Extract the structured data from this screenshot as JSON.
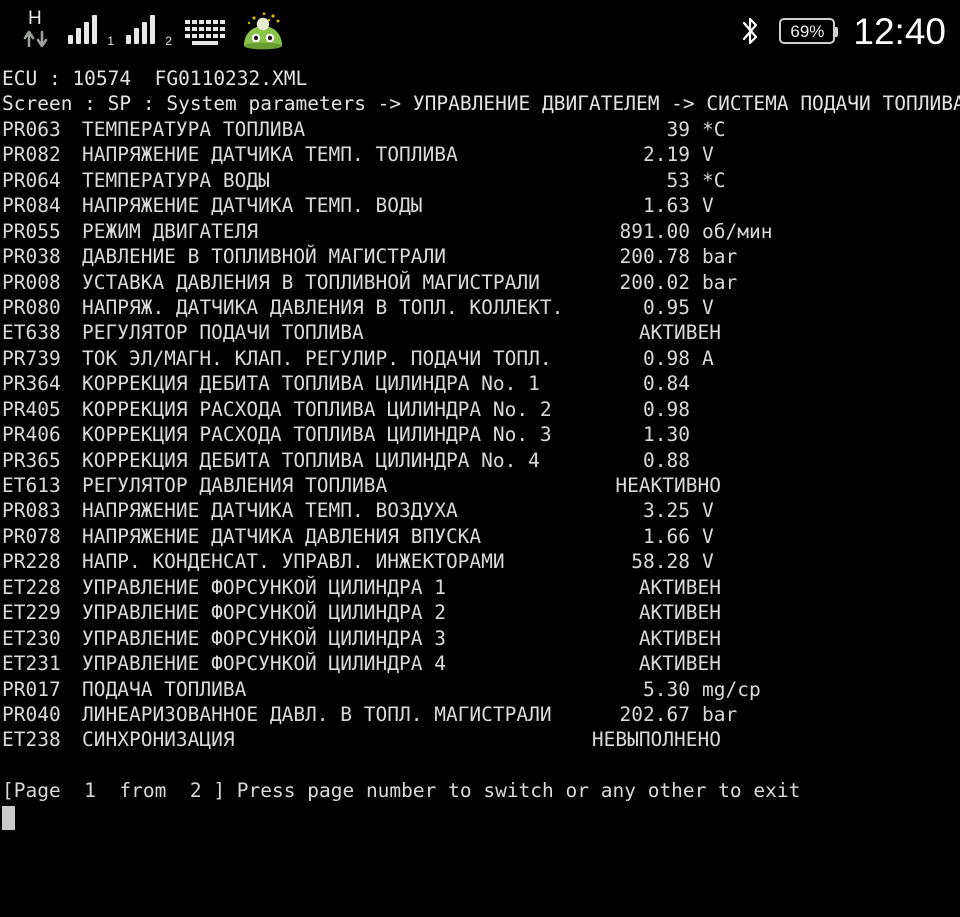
{
  "statusbar": {
    "network_type": "H",
    "sim1_label": "1",
    "sim2_label": "2",
    "icons": [
      "h-network-icon",
      "signal-bars-sim1-icon",
      "signal-bars-sim2-icon",
      "keyboard-icon",
      "android-mascot-icon",
      "bluetooth-icon"
    ],
    "battery_percent": "69%",
    "clock": "12:40",
    "colors": {
      "text": "#e8e8e8",
      "background": "#000000",
      "mascot_green": "#8bc34a"
    }
  },
  "header": {
    "ecu_line": "ECU : 10574  FG0110232.XML",
    "screen_line": "Screen : SP : System parameters -> УПРАВЛЕНИЕ ДВИГАТЕЛЕМ -> СИСТЕМА ПОДАЧИ ТОПЛИВА"
  },
  "rows": [
    {
      "code": "PR063",
      "label": "ТЕМПЕРАТУРА ТОПЛИВА",
      "value": "39",
      "unit": "*C",
      "kind": "num"
    },
    {
      "code": "PR082",
      "label": "НАПРЯЖЕНИЕ ДАТЧИКА ТЕМП. ТОПЛИВА",
      "value": "2.19",
      "unit": "V",
      "kind": "num"
    },
    {
      "code": "PR064",
      "label": "ТЕМПЕРАТУРА ВОДЫ",
      "value": "53",
      "unit": "*C",
      "kind": "num"
    },
    {
      "code": "PR084",
      "label": "НАПРЯЖЕНИЕ ДАТЧИКА ТЕМП. ВОДЫ",
      "value": "1.63",
      "unit": "V",
      "kind": "num"
    },
    {
      "code": "PR055",
      "label": "РЕЖИМ ДВИГАТЕЛЯ",
      "value": "891.00",
      "unit": "об/мин",
      "kind": "num"
    },
    {
      "code": "PR038",
      "label": "ДАВЛЕНИЕ В ТОПЛИВНОЙ МАГИСТРАЛИ",
      "value": "200.78",
      "unit": "bar",
      "kind": "num"
    },
    {
      "code": "PR008",
      "label": "УСТАВКА ДАВЛЕНИЯ В ТОПЛИВНОЙ МАГИСТРАЛИ",
      "value": "200.02",
      "unit": "bar",
      "kind": "num"
    },
    {
      "code": "PR080",
      "label": "НАПРЯЖ. ДАТЧИКА ДАВЛЕНИЯ В ТОПЛ. КОЛЛЕКТ.",
      "value": "0.95",
      "unit": "V",
      "kind": "num"
    },
    {
      "code": "ET638",
      "label": "РЕГУЛЯТОР ПОДАЧИ ТОПЛИВА",
      "value": "АКТИВЕН",
      "unit": "",
      "kind": "state"
    },
    {
      "code": "PR739",
      "label": "ТОК ЭЛ/МАГН. КЛАП. РЕГУЛИР. ПОДАЧИ ТОПЛ.",
      "value": "0.98",
      "unit": "A",
      "kind": "num"
    },
    {
      "code": "PR364",
      "label": "КОРРЕКЦИЯ ДЕБИТА ТОПЛИВА ЦИЛИНДРА No. 1",
      "value": "0.84",
      "unit": "",
      "kind": "num"
    },
    {
      "code": "PR405",
      "label": "КОРРЕКЦИЯ РАСХОДА ТОПЛИВА ЦИЛИНДРА No. 2",
      "value": "0.98",
      "unit": "",
      "kind": "num"
    },
    {
      "code": "PR406",
      "label": "КОРРЕКЦИЯ РАСХОДА ТОПЛИВА ЦИЛИНДРА No. 3",
      "value": "1.30",
      "unit": "",
      "kind": "num"
    },
    {
      "code": "PR365",
      "label": "КОРРЕКЦИЯ ДЕБИТА ТОПЛИВА ЦИЛИНДРА No. 4",
      "value": "0.88",
      "unit": "",
      "kind": "num"
    },
    {
      "code": "ET613",
      "label": "РЕГУЛЯТОР ДАВЛЕНИЯ ТОПЛИВА",
      "value": "НЕАКТИВНО",
      "unit": "",
      "kind": "state"
    },
    {
      "code": "PR083",
      "label": "НАПРЯЖЕНИЕ ДАТЧИКА ТЕМП. ВОЗДУХА",
      "value": "3.25",
      "unit": "V",
      "kind": "num"
    },
    {
      "code": "PR078",
      "label": "НАПРЯЖЕНИЕ ДАТЧИКА ДАВЛЕНИЯ ВПУСКА",
      "value": "1.66",
      "unit": "V",
      "kind": "num"
    },
    {
      "code": "PR228",
      "label": "НАПР. КОНДЕНСАТ. УПРАВЛ. ИНЖЕКТОРАМИ",
      "value": "58.28",
      "unit": "V",
      "kind": "num"
    },
    {
      "code": "ET228",
      "label": "УПРАВЛЕНИЕ ФОРСУНКОЙ ЦИЛИНДРА 1",
      "value": "АКТИВЕН",
      "unit": "",
      "kind": "state"
    },
    {
      "code": "ET229",
      "label": "УПРАВЛЕНИЕ ФОРСУНКОЙ ЦИЛИНДРА 2",
      "value": "АКТИВЕН",
      "unit": "",
      "kind": "state"
    },
    {
      "code": "ET230",
      "label": "УПРАВЛЕНИЕ ФОРСУНКОЙ ЦИЛИНДРА 3",
      "value": "АКТИВЕН",
      "unit": "",
      "kind": "state"
    },
    {
      "code": "ET231",
      "label": "УПРАВЛЕНИЕ ФОРСУНКОЙ ЦИЛИНДРА 4",
      "value": "АКТИВЕН",
      "unit": "",
      "kind": "state"
    },
    {
      "code": "PR017",
      "label": "ПОДАЧА ТОПЛИВА",
      "value": "5.30",
      "unit": "mg/cp",
      "kind": "num"
    },
    {
      "code": "PR040",
      "label": "ЛИНЕАРИЗОВАННОЕ ДАВЛ. В ТОПЛ. МАГИСТРАЛИ",
      "value": "202.67",
      "unit": "bar",
      "kind": "num"
    },
    {
      "code": "ET238",
      "label": "СИНХРОНИЗАЦИЯ",
      "value": "НЕВЫПОЛНЕНО",
      "unit": "",
      "kind": "state"
    }
  ],
  "footer": {
    "text": "[Page  1  from  2 ] Press page number to switch or any other to exit",
    "page_current": "1",
    "page_total": "2"
  }
}
